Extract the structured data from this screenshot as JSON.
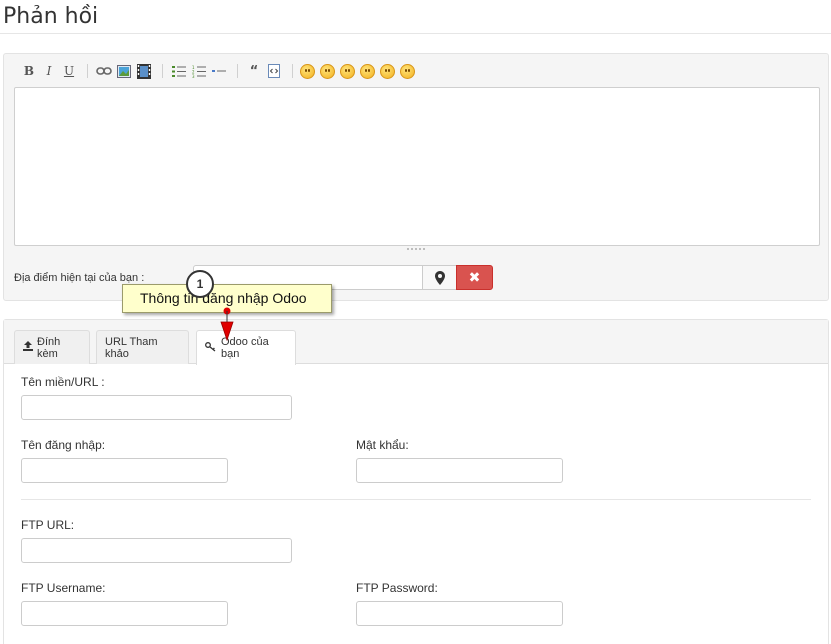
{
  "page": {
    "title": "Phản hồi"
  },
  "toolbar": {
    "bold": "B",
    "italic": "I",
    "underline": "U",
    "icons": [
      "link-icon",
      "image-icon",
      "video-icon",
      "bullet-list-icon",
      "numbered-list-icon",
      "horizontal-rule-icon",
      "quote-icon",
      "code-icon",
      "emoji-laugh-icon",
      "emoji-grin-icon",
      "emoji-angry-icon",
      "emoji-surprised-icon",
      "emoji-smile-icon",
      "emoji-wink-icon"
    ]
  },
  "location": {
    "label": "Địa điểm hiện tại của bạn :",
    "value": "",
    "locate_icon": "map-marker-icon",
    "delete_icon": "close-icon",
    "delete_label": "✖"
  },
  "callout": {
    "number": "1",
    "text": "Thông tin đăng nhập Odoo"
  },
  "tabs": [
    {
      "label": "Đính kèm",
      "icon": "upload-icon"
    },
    {
      "label": "URL Tham khảo"
    },
    {
      "label": "Odoo của bạn",
      "icon": "key-icon",
      "active": true
    }
  ],
  "form": {
    "domain_label": "Tên miền/URL :",
    "username_label": "Tên đăng nhập:",
    "password_label": "Mật khẩu:",
    "ftp_url_label": "FTP URL:",
    "ftp_username_label": "FTP Username:",
    "ftp_password_label": "FTP Password:"
  },
  "colors": {
    "danger": "#d9534f",
    "callout_bg": "#ffffcc",
    "arrow": "#e00000"
  }
}
